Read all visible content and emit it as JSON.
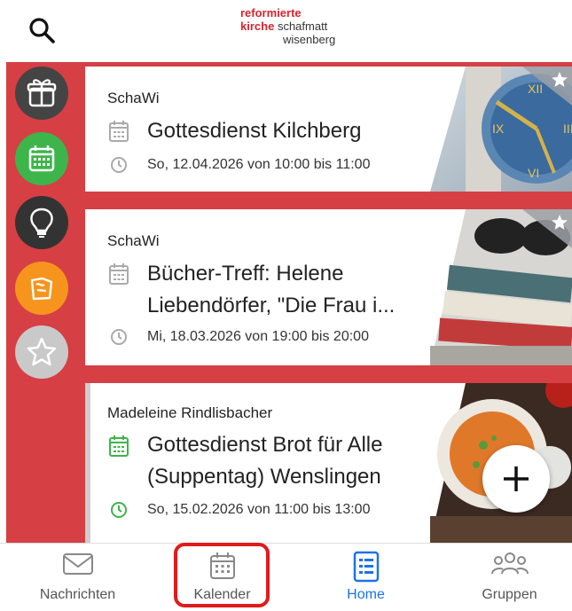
{
  "header": {
    "logo_line1": "reformierte",
    "logo_line2a": "kirche",
    "logo_line2b": "schafmatt",
    "logo_line3": "wisenberg"
  },
  "sidebar": [
    {
      "icon": "gift-icon",
      "color": "#444444"
    },
    {
      "icon": "calendar-icon",
      "color": "#3db54a"
    },
    {
      "icon": "lightbulb-icon",
      "color": "#333333"
    },
    {
      "icon": "puzzle-icon",
      "color": "#f7941d"
    },
    {
      "icon": "star-icon",
      "color": "#c9c9c9"
    }
  ],
  "events": [
    {
      "author": "SchaWi",
      "title_line1": "Gottesdienst Kilchberg",
      "title_line2": "",
      "time": "So, 12.04.2026 von 10:00 bis 11:00",
      "icon_color": "#aaaaaa",
      "image": "clock-tower"
    },
    {
      "author": "SchaWi",
      "title_line1": "Bücher-Treff: Helene",
      "title_line2": "Liebendörfer, \"Die Frau i...",
      "time": "Mi, 18.03.2026 von 19:00 bis 20:00",
      "icon_color": "#aaaaaa",
      "image": "books"
    },
    {
      "author": "Madeleine Rindlisbacher",
      "title_line1": "Gottesdienst Brot für Alle",
      "title_line2": "(Suppentag) Wenslingen",
      "time": "So, 15.02.2026 von 11:00 bis 13:00",
      "icon_color": "#3db54a",
      "image": "soup"
    }
  ],
  "nav": {
    "items": [
      {
        "label": "Nachrichten",
        "icon": "envelope-icon"
      },
      {
        "label": "Kalender",
        "icon": "calendar-icon"
      },
      {
        "label": "Home",
        "icon": "list-icon"
      },
      {
        "label": "Gruppen",
        "icon": "group-icon"
      }
    ],
    "active": "Home",
    "active_color": "#1a73e8"
  }
}
